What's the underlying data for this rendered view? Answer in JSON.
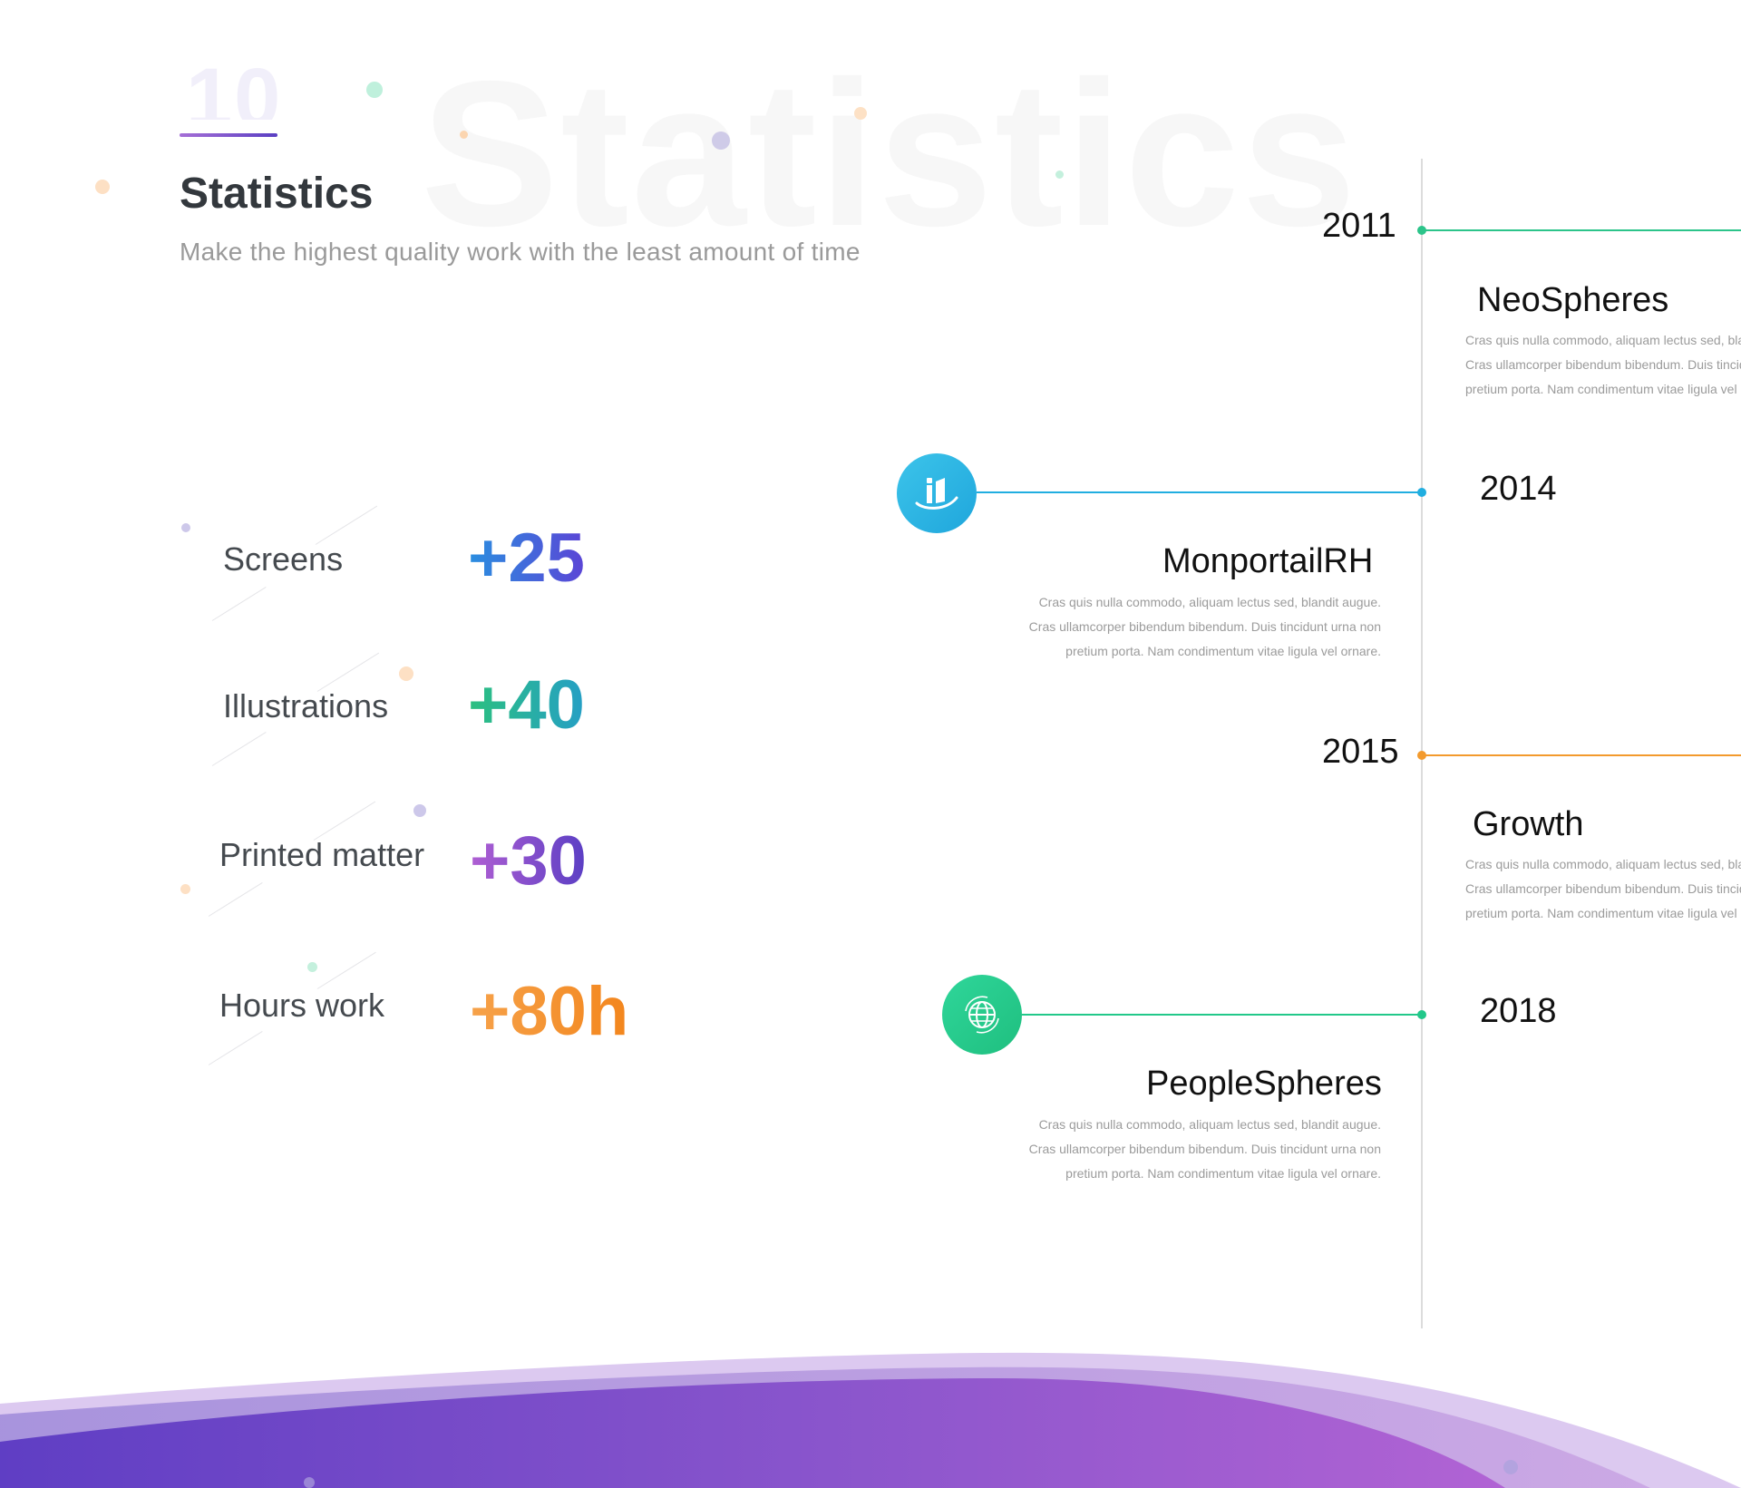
{
  "header": {
    "section_number": "10",
    "background_word": "Statistics",
    "title": "Statistics",
    "subtitle": "Make the highest quality work with the least amount of time"
  },
  "stats": [
    {
      "label": "Screens",
      "value": "+25",
      "color": "#3b6fe0"
    },
    {
      "label": "Illustrations",
      "value": "+40",
      "color": "#2bb29a"
    },
    {
      "label": "Printed matter",
      "value": "+30",
      "color": "#8a4fcf"
    },
    {
      "label": "Hours work",
      "value": "+80h",
      "color": "#f5952e"
    }
  ],
  "timeline": {
    "items": [
      {
        "year": "2011",
        "title": "NeoSpheres",
        "side": "right",
        "color": "#2cc48a",
        "desc": [
          "Cras quis nulla commodo, aliquam lectus sed, blandit augue.",
          "Cras ullamcorper bibendum bibendum. Duis tincidunt urna non",
          "pretium porta. Nam condimentum vitae ligula vel ornare."
        ]
      },
      {
        "year": "2014",
        "title": "MonportailRH",
        "side": "left",
        "color": "#21aee0",
        "icon": "monportail-logo-icon",
        "desc": [
          "Cras quis nulla commodo, aliquam lectus sed, blandit augue.",
          "Cras ullamcorper bibendum bibendum. Duis tincidunt urna non",
          "pretium porta. Nam condimentum vitae ligula vel ornare."
        ]
      },
      {
        "year": "2015",
        "title": "Growth",
        "side": "right",
        "color": "#f39a2d",
        "desc": [
          "Cras quis nulla commodo, aliquam lectus sed, blandit augue.",
          "Cras ullamcorper bibendum bibendum. Duis tincidunt urna non",
          "pretium porta. Nam condimentum vitae ligula vel ornare."
        ]
      },
      {
        "year": "2018",
        "title": "PeopleSpheres",
        "side": "left",
        "color": "#22c88a",
        "icon": "globe-icon",
        "desc": [
          "Cras quis nulla commodo, aliquam lectus sed, blandit augue.",
          "Cras ullamcorper bibendum bibendum. Duis tincidunt urna non",
          "pretium porta. Nam condimentum vitae ligula vel ornare."
        ]
      }
    ]
  },
  "colors": {
    "accent_purple": "#7b4fcf",
    "wave_dark": "#6a44c8",
    "wave_light": "#d9c6ef"
  }
}
